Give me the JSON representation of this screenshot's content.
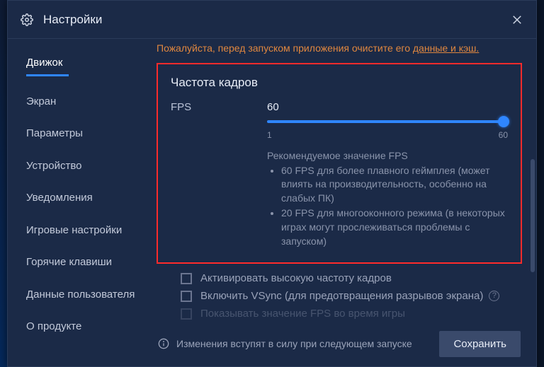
{
  "title": "Настройки",
  "sidebar": {
    "items": [
      {
        "label": "Движок",
        "active": true
      },
      {
        "label": "Экран"
      },
      {
        "label": "Параметры"
      },
      {
        "label": "Устройство"
      },
      {
        "label": "Уведомления"
      },
      {
        "label": "Игровые настройки"
      },
      {
        "label": "Горячие клавиши"
      },
      {
        "label": "Данные пользователя"
      },
      {
        "label": "О продукте"
      }
    ]
  },
  "warning": {
    "text_prefix": "Пожалуйста, перед запуском приложения очистите его ",
    "link_text": "данные и кэш."
  },
  "fps": {
    "section_title": "Частота кадров",
    "label": "FPS",
    "value": "60",
    "min": "1",
    "max": "60",
    "reco_title": "Рекомендуемое значение FPS",
    "reco_items": [
      "60 FPS для более плавного геймплея (может влиять на производительность, особенно на слабых ПК)",
      "20 FPS для многооконного режима (в некоторых играх могут прослеживаться проблемы с запуском)"
    ]
  },
  "checks": {
    "high_fps": "Активировать высокую частоту кадров",
    "vsync": "Включить VSync (для предотвращения разрывов экрана)",
    "show_fps": "Показывать значение FPS во время игры"
  },
  "footer": {
    "note": "Изменения вступят в силу при следующем запуске",
    "save": "Сохранить"
  }
}
